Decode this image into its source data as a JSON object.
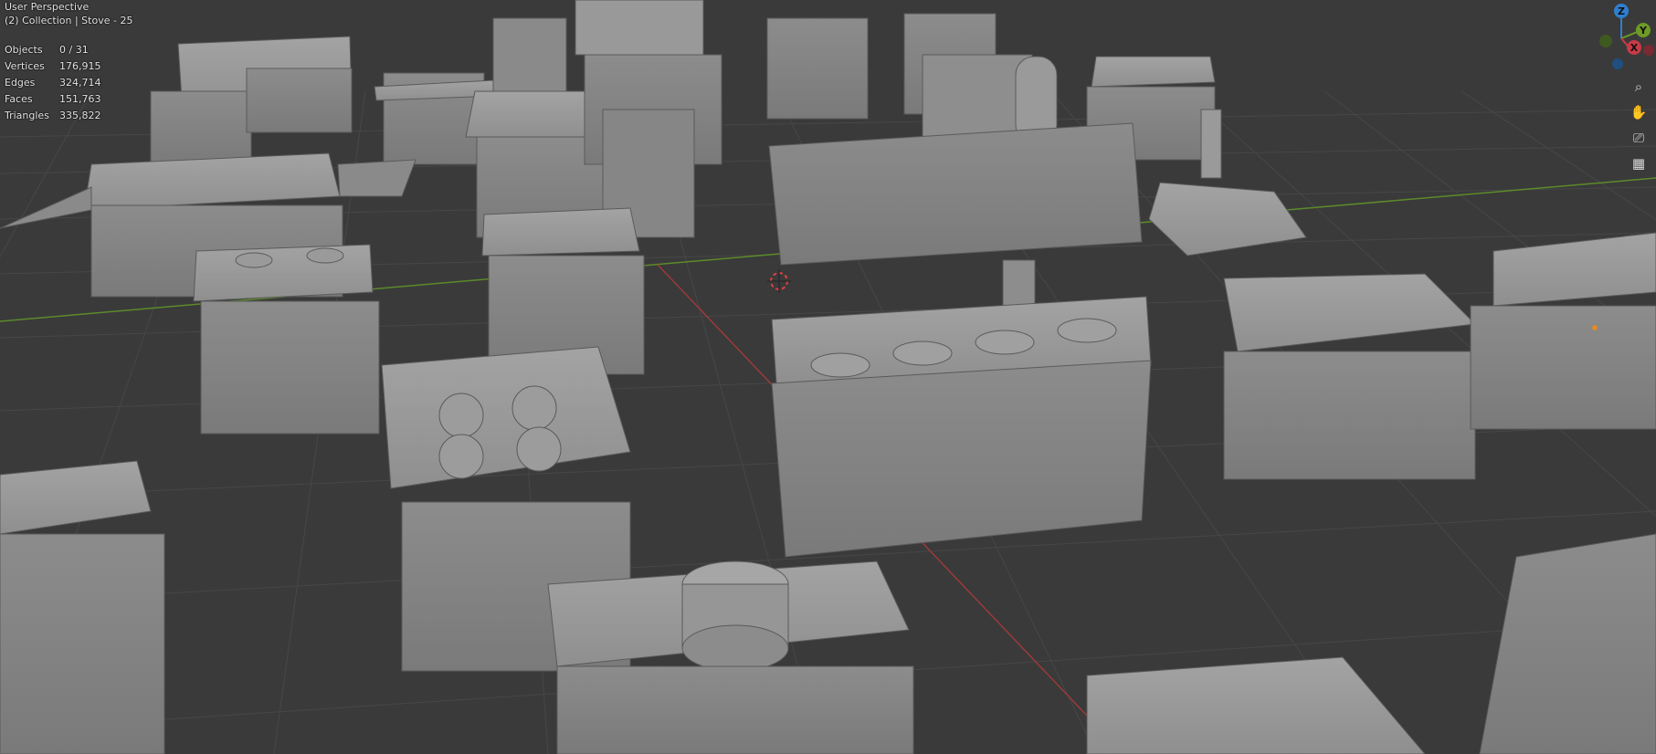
{
  "viewport": {
    "view_name": "User Perspective",
    "collection_label": "(2) Collection | Stove - 25",
    "stats": [
      {
        "label": "Objects",
        "value": "0 / 31"
      },
      {
        "label": "Vertices",
        "value": "176,915"
      },
      {
        "label": "Edges",
        "value": "324,714"
      },
      {
        "label": "Faces",
        "value": "151,763"
      },
      {
        "label": "Triangles",
        "value": "335,822"
      }
    ]
  },
  "gizmo": {
    "z_label": "Z",
    "y_label": "Y",
    "x_label": "X",
    "colors": {
      "x": "#c73a46",
      "y": "#6e9a25",
      "z": "#2f7fcf"
    }
  },
  "nav_tools": [
    {
      "name": "zoom-icon",
      "glyph": "⌕"
    },
    {
      "name": "hand-pan-icon",
      "glyph": "✋"
    },
    {
      "name": "camera-icon",
      "glyph": "⎚"
    },
    {
      "name": "grid-ortho-icon",
      "glyph": "▦"
    }
  ],
  "colors": {
    "background": "#3a3a3a",
    "grid": "#4a4a4a",
    "x_axis": "#9a3a3a",
    "y_axis": "#5d8a2a",
    "model": "#8d8d8d"
  }
}
